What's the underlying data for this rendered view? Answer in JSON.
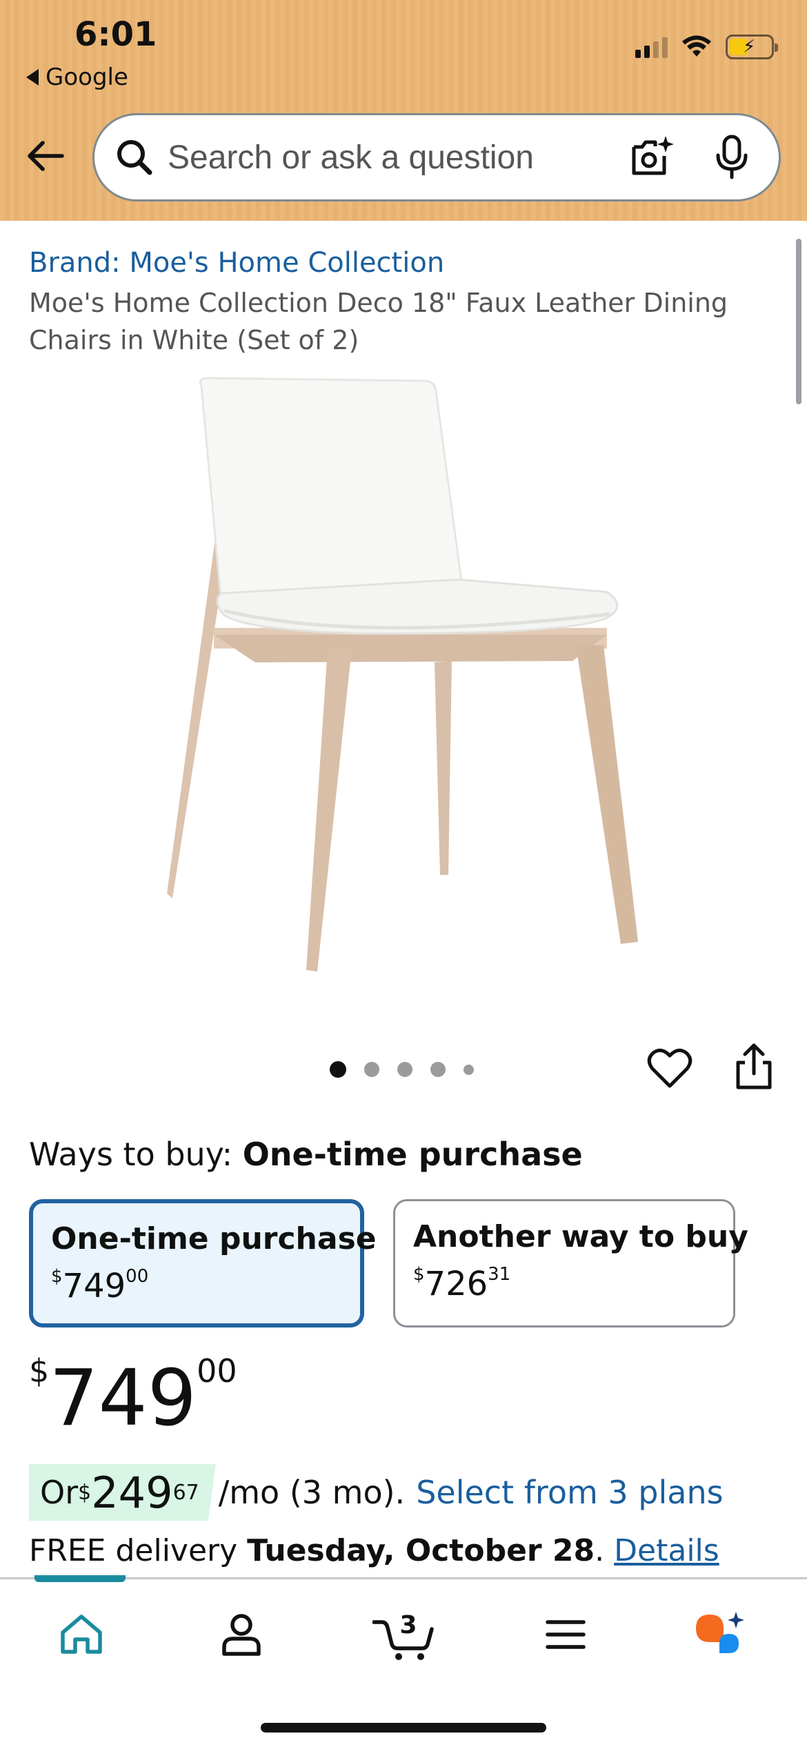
{
  "status_bar": {
    "time": "6:01",
    "back_app": "Google"
  },
  "search": {
    "placeholder": "Search or ask a question"
  },
  "product": {
    "brand": "Brand: Moe's Home Collection",
    "title": "Moe's Home Collection Deco 18\" Faux Leather Dining Chairs in White (Set of 2)",
    "image_count": 5,
    "active_image": 1
  },
  "ways_to_buy": {
    "label": "Ways to buy: ",
    "selected": "One-time purchase",
    "options": [
      {
        "label": "One-time purchase",
        "currency": "$",
        "whole": "749",
        "fraction": "00"
      },
      {
        "label": "Another way to buy",
        "currency": "$",
        "whole": "726",
        "fraction": "31"
      }
    ]
  },
  "price": {
    "currency": "$",
    "whole": "749",
    "fraction": "00"
  },
  "installment": {
    "prefix": "Or ",
    "currency": "$",
    "whole": "249",
    "fraction": "67",
    "suffix": "/mo (3 mo).",
    "link": "Select from 3 plans"
  },
  "delivery": {
    "prefix": "FREE delivery ",
    "date": "Tuesday, October 28",
    "sep": ". ",
    "link": "Details"
  },
  "bottom_nav": {
    "cart_count": "3",
    "items": [
      "home-icon",
      "account-icon",
      "cart-icon",
      "menu-icon",
      "rufus-ai-icon"
    ]
  },
  "colors": {
    "header": "#ebb87a",
    "link": "#1a5e9d",
    "selected_border": "#2162a1",
    "installment_bg": "#d8f5e6",
    "nav_active": "#1a8b9e"
  }
}
